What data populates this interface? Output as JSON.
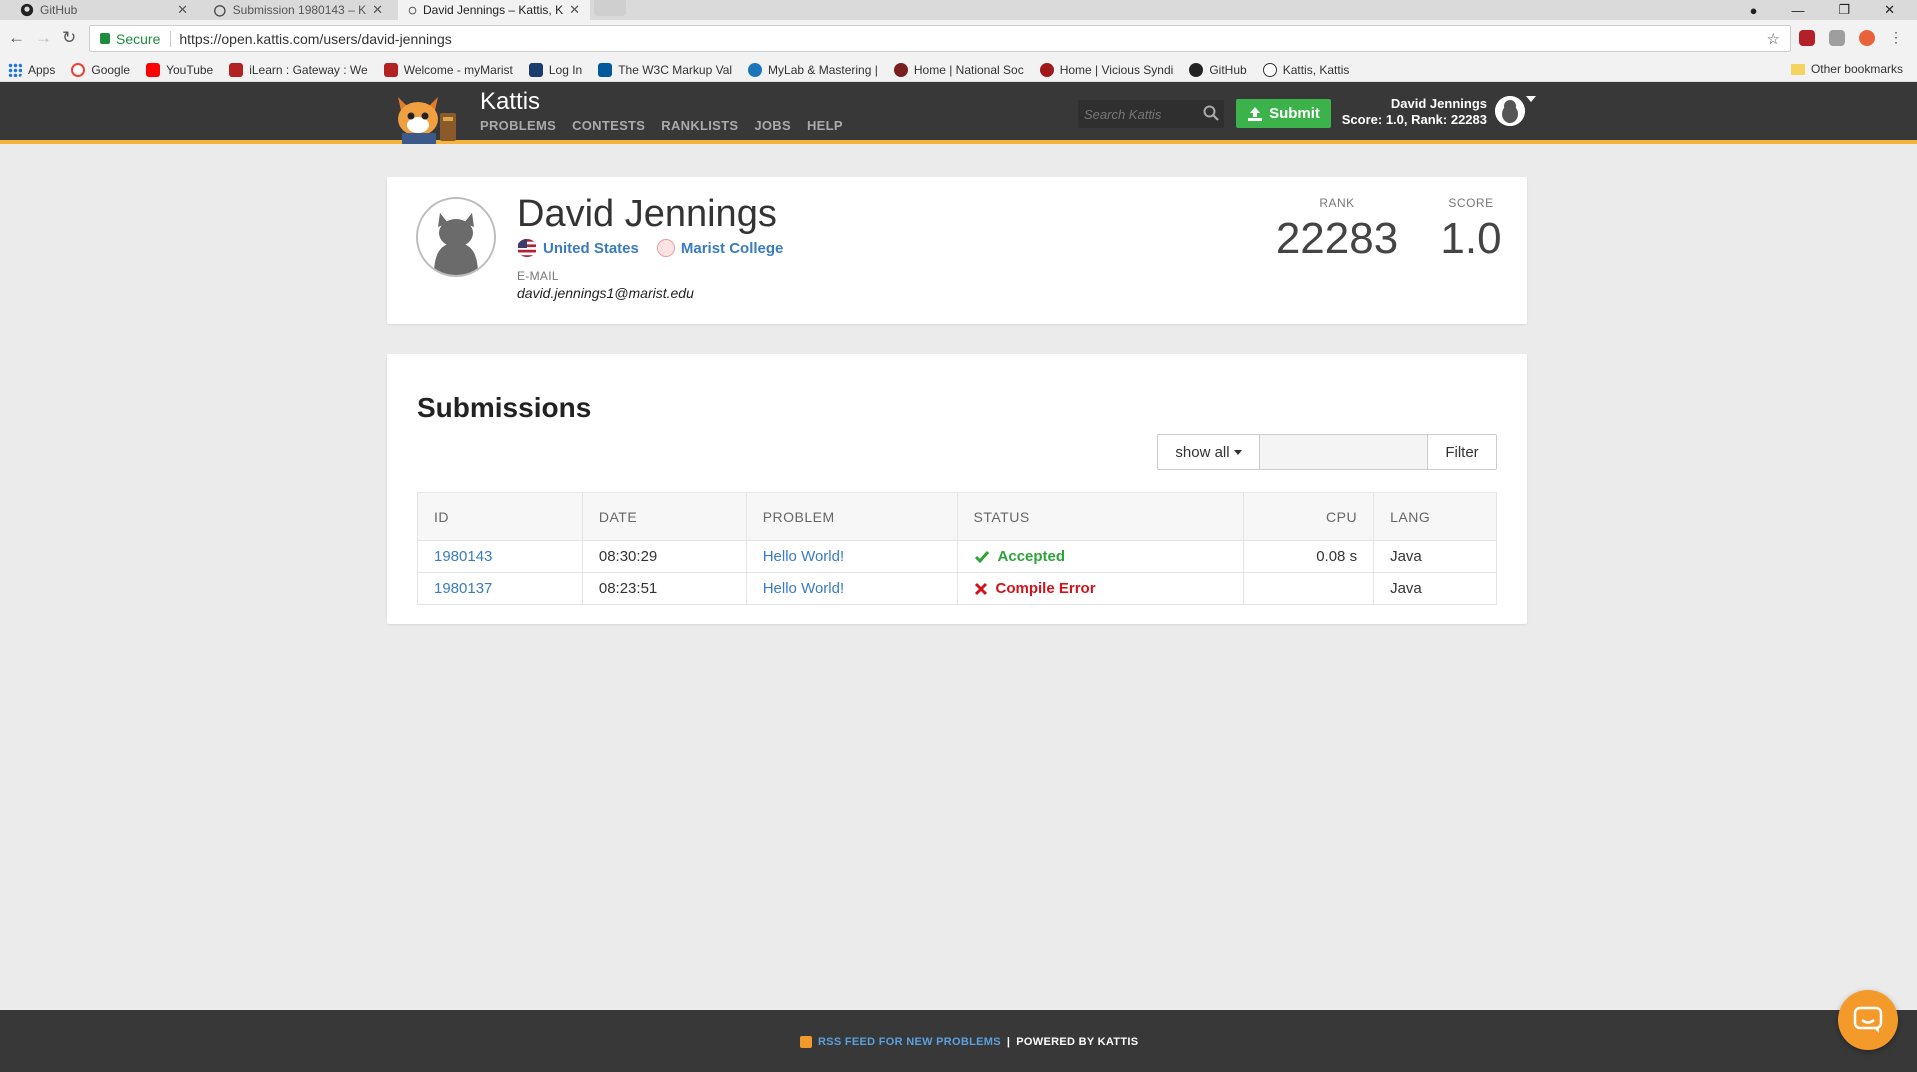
{
  "browser": {
    "tabs": [
      {
        "title": "GitHub",
        "active": false
      },
      {
        "title": "Submission 1980143 – K",
        "active": false
      },
      {
        "title": "David Jennings – Kattis, K",
        "active": true
      }
    ],
    "url_secure_label": "Secure",
    "url": "https://open.kattis.com/users/david-jennings",
    "bookmarks": [
      {
        "label": "Apps",
        "color": "#1a73e8"
      },
      {
        "label": "Google",
        "color": "#ea4335"
      },
      {
        "label": "YouTube",
        "color": "#ff0000"
      },
      {
        "label": "iLearn : Gateway : We",
        "color": "#b22222"
      },
      {
        "label": "Welcome - myMarist",
        "color": "#b22222"
      },
      {
        "label": "Log In",
        "color": "#1a3d6d"
      },
      {
        "label": "The W3C Markup Val",
        "color": "#005a9c"
      },
      {
        "label": "MyLab & Mastering |",
        "color": "#1b75bb"
      },
      {
        "label": "Home | National Soc",
        "color": "#7a1f1f"
      },
      {
        "label": "Home | Vicious Syndi",
        "color": "#a01818"
      },
      {
        "label": "GitHub",
        "color": "#222222"
      },
      {
        "label": "Kattis, Kattis",
        "color": "#333333"
      }
    ],
    "other_bookmarks": "Other bookmarks"
  },
  "site": {
    "brand": "Kattis",
    "nav": [
      "PROBLEMS",
      "CONTESTS",
      "RANKLISTS",
      "JOBS",
      "HELP"
    ],
    "search_placeholder": "Search Kattis",
    "submit_label": "Submit",
    "user_name": "David Jennings",
    "user_stats": "Score: 1.0, Rank: 22283",
    "accent_color": "#f3b43e",
    "submit_color": "#3cb34a"
  },
  "profile": {
    "name": "David Jennings",
    "country": "United States",
    "college": "Marist College",
    "email_label": "E-MAIL",
    "email": "david.jennings1@marist.edu",
    "rank_label": "RANK",
    "rank": "22283",
    "score_label": "SCORE",
    "score": "1.0"
  },
  "submissions": {
    "title": "Submissions",
    "filter_select": "show all",
    "filter_button": "Filter",
    "columns": [
      "ID",
      "DATE",
      "PROBLEM",
      "STATUS",
      "CPU",
      "LANG"
    ],
    "rows": [
      {
        "id": "1980143",
        "date": "08:30:29",
        "problem": "Hello World!",
        "status": "Accepted",
        "status_icon": "check-icon",
        "cpu": "0.08 s",
        "lang": "Java"
      },
      {
        "id": "1980137",
        "date": "08:23:51",
        "problem": "Hello World!",
        "status": "Compile Error",
        "status_icon": "x-icon",
        "cpu": "",
        "lang": "Java"
      }
    ]
  },
  "footer": {
    "rss": "RSS FEED FOR NEW PROBLEMS",
    "separator": "|",
    "powered": "POWERED BY KATTIS"
  }
}
